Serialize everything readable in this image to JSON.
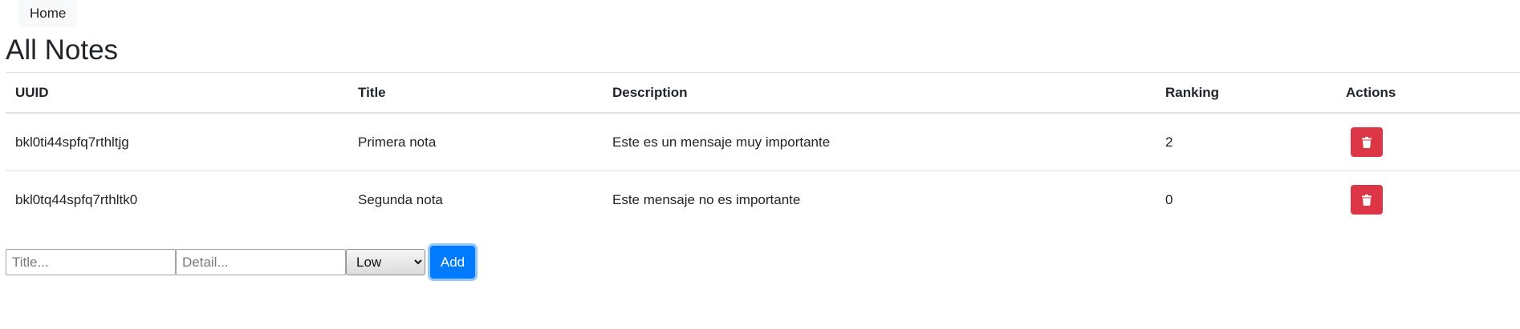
{
  "nav": {
    "home_label": "Home"
  },
  "page": {
    "title": "All Notes"
  },
  "table": {
    "headers": {
      "uuid": "UUID",
      "title": "Title",
      "description": "Description",
      "ranking": "Ranking",
      "actions": "Actions"
    },
    "rows": [
      {
        "uuid": "bkl0ti44spfq7rthltjg",
        "title": "Primera nota",
        "description": "Este es un mensaje muy importante",
        "ranking": "2",
        "action_icon": "trash-icon"
      },
      {
        "uuid": "bkl0tq44spfq7rthltk0",
        "title": "Segunda nota",
        "description": "Este mensaje no es importante",
        "ranking": "0",
        "action_icon": "trash-icon"
      }
    ]
  },
  "form": {
    "title_placeholder": "Title...",
    "title_value": "",
    "detail_placeholder": "Detail...",
    "detail_value": "",
    "priority_selected": "Low",
    "add_label": "Add"
  },
  "colors": {
    "danger": "#dc3545",
    "primary": "#007bff",
    "nav_background": "#f8f9fa",
    "table_border": "#dee2e6"
  }
}
